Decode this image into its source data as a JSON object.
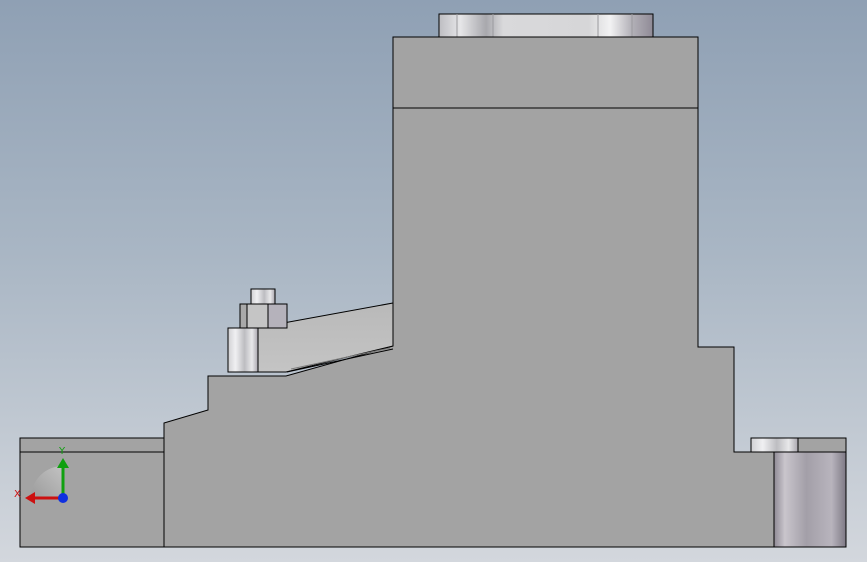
{
  "viewport": {
    "background_top": "#8fa0b4",
    "background_bottom": "#d3d7dd"
  },
  "model": {
    "face_color": "#a3a3a3",
    "edge_color": "#000000",
    "cylinder_color": "#c9c9cc",
    "shadow_color": "#8d8894"
  },
  "triad": {
    "x_label": "X",
    "y_label": "Y",
    "x_color": "#cc1010",
    "y_color": "#10a010",
    "z_color": "#1030e0"
  }
}
